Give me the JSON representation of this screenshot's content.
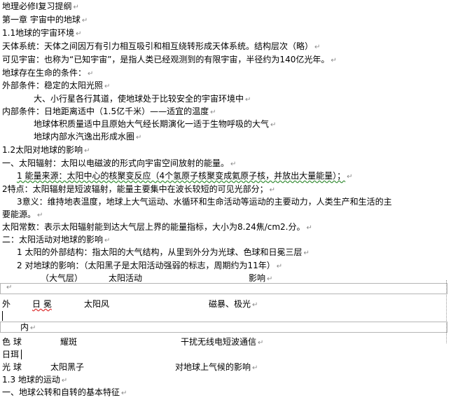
{
  "lines": [
    "地理必修Ⅰ复习提纲",
    "第一章 宇宙中的地球",
    "1.1地球的宇宙环境",
    "天体系统：天体之间因万有引力相互吸引和相互绕转形成天体系统。结构层次（略）",
    "可见宇宙：也称为“已知宇宙”，是指人类已经观测到的有限宇宙，半径约为140亿光年。",
    "地球存在生命的条件：",
    "外部条件：稳定的太阳光照",
    "大、小行星各行其道，使地球处于比较安全的宇宙环境中",
    "内部条件：日地距离适中（1.5亿千米）——适宜的温度",
    "地球体积质量适中且原始大气经长期演化一适于生物呼吸的大气",
    "地球内部水汽逸出形成水圈",
    "1.2太阳对地球的影响",
    "一、太阳辐射：太阳以电磁波的形式向宇宙空间放射的能量。",
    "1 能量来源：太阳中心的核聚变反应（4个氢原子核聚变成氦原子核，并放出大量能量）；",
    "2特点：太阳辐射是短波辐射，能量主要集中在波长较短的可见光部分；",
    "3意义：维持地表温度，地球上大气运动、水循环和生命活动等运动的主要动力，人类生产和生活的主",
    "要能源。",
    "太阳常数：表示太阳辐射能到达大气层上界的能量指标，大小为8.24焦/cm2.分。",
    "二：太阳活动对地球的影响",
    "1 太阳的外部结构：指太阳的大气结构，从里到外分为光球、色球和日冕三层",
    "2 对地球的影响：（太阳黑子是太阳活动强弱的标志，周期约为11年）"
  ],
  "table": {
    "header": [
      "（大气层）",
      "太阳活动",
      "影响"
    ],
    "row1": [
      "外",
      "日 冕",
      "太阳风",
      "磁暴、极光"
    ],
    "row1b": "内",
    "row2": [
      "色 球",
      "耀斑",
      "干扰无线电短波通信"
    ],
    "row2b": "日珥",
    "row3": [
      "光 球",
      "太阳黑子",
      "对地球上气候的影响"
    ]
  },
  "tail": [
    "1.3 地球的运动",
    "一、地球公转和自转的基本特征"
  ],
  "para_mark": "↵"
}
